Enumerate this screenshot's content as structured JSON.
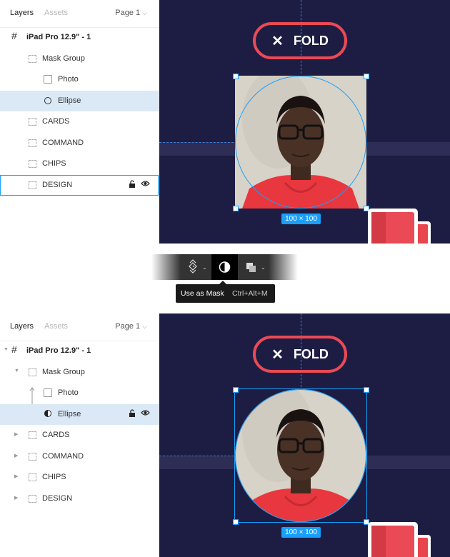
{
  "top": {
    "tabs": {
      "layers": "Layers",
      "assets": "Assets",
      "page": "Page 1"
    },
    "layers": [
      {
        "label": "iPad Pro 12.9\" - 1",
        "icon": "frame-hash-icon",
        "indent": 0
      },
      {
        "label": "Mask Group",
        "icon": "group-icon",
        "indent": 1
      },
      {
        "label": "Photo",
        "icon": "image-icon",
        "indent": 2
      },
      {
        "label": "Ellipse",
        "icon": "ellipse-icon",
        "indent": 2,
        "selected": true
      },
      {
        "label": "CARDS",
        "icon": "group-icon",
        "indent": 1
      },
      {
        "label": "COMMAND",
        "icon": "group-icon",
        "indent": 1
      },
      {
        "label": "CHIPS",
        "icon": "group-icon",
        "indent": 1
      },
      {
        "label": "DESIGN",
        "icon": "group-icon",
        "indent": 1,
        "hovered": true
      }
    ],
    "canvas": {
      "fold_label": "FOLD",
      "size_label": "100 × 100"
    }
  },
  "toolbar": {
    "items": [
      "component-icon",
      "mask-icon",
      "boolean-icon"
    ],
    "tooltip_label": "Use as Mask",
    "tooltip_shortcut": "Ctrl+Alt+M"
  },
  "bottom": {
    "tabs": {
      "layers": "Layers",
      "assets": "Assets",
      "page": "Page 1"
    },
    "layers": [
      {
        "label": "iPad Pro 12.9\" - 1",
        "icon": "frame-hash-icon",
        "indent": 0,
        "expanded": true
      },
      {
        "label": "Mask Group",
        "icon": "group-icon",
        "indent": 1,
        "expanded": true
      },
      {
        "label": "Photo",
        "icon": "image-icon",
        "indent": 2
      },
      {
        "label": "Ellipse",
        "icon": "mask-icon",
        "indent": 2,
        "selected": true
      },
      {
        "label": "CARDS",
        "icon": "group-icon",
        "indent": 1
      },
      {
        "label": "COMMAND",
        "icon": "group-icon",
        "indent": 1
      },
      {
        "label": "CHIPS",
        "icon": "group-icon",
        "indent": 1
      },
      {
        "label": "DESIGN",
        "icon": "group-icon",
        "indent": 1
      }
    ],
    "canvas": {
      "fold_label": "FOLD",
      "size_label": "100 × 100"
    }
  },
  "colors": {
    "canvas": "#1d1d44",
    "accent": "#18a0fb",
    "fold_red": "#e94a55",
    "selection": "#dbe9f6"
  }
}
